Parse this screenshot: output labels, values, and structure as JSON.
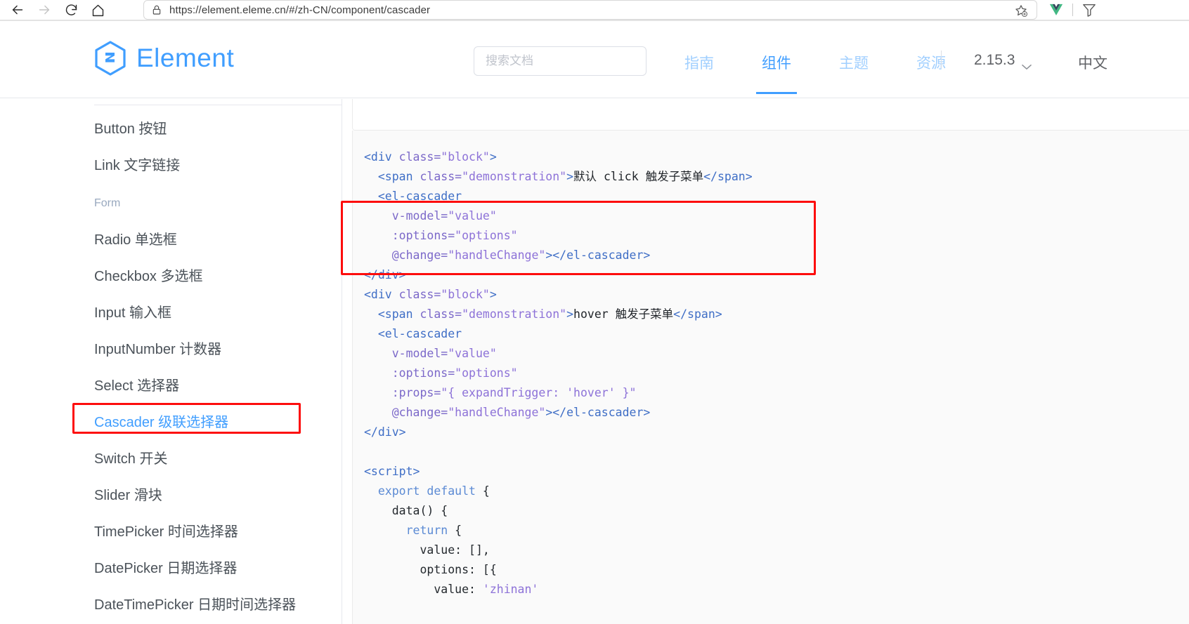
{
  "browser": {
    "back_label": "Back",
    "forward_label": "Forward",
    "reload_label": "Reload",
    "home_label": "Home",
    "url": "https://element.eleme.cn/#/zh-CN/component/cascader",
    "lock_icon": "lock-icon",
    "bookmark_icon": "bookmark-star-add-icon",
    "extension_icon": "vue-devtools-icon",
    "extension2_icon": "extension-icon"
  },
  "header": {
    "logo_text": "Element",
    "logo_icon": "element-hexagon-logo",
    "search": {
      "placeholder": "搜索文档",
      "value": ""
    },
    "nav": [
      {
        "label": "指南",
        "active": false
      },
      {
        "label": "组件",
        "active": true
      },
      {
        "label": "主题",
        "active": false
      },
      {
        "label": "资源",
        "active": false
      }
    ],
    "version": "2.15.3",
    "version_chevron": "chevron-down-icon",
    "language": "中文"
  },
  "sidebar": {
    "items": [
      {
        "label": "Button 按钮",
        "type": "item",
        "active": false
      },
      {
        "label": "Link 文字链接",
        "type": "item",
        "active": false
      },
      {
        "label": "Form",
        "type": "group",
        "active": false
      },
      {
        "label": "Radio 单选框",
        "type": "item",
        "active": false
      },
      {
        "label": "Checkbox 多选框",
        "type": "item",
        "active": false
      },
      {
        "label": "Input 输入框",
        "type": "item",
        "active": false
      },
      {
        "label": "InputNumber 计数器",
        "type": "item",
        "active": false
      },
      {
        "label": "Select 选择器",
        "type": "item",
        "active": false
      },
      {
        "label": "Cascader 级联选择器",
        "type": "item",
        "active": true
      },
      {
        "label": "Switch 开关",
        "type": "item",
        "active": false
      },
      {
        "label": "Slider 滑块",
        "type": "item",
        "active": false
      },
      {
        "label": "TimePicker 时间选择器",
        "type": "item",
        "active": false
      },
      {
        "label": "DatePicker 日期选择器",
        "type": "item",
        "active": false
      },
      {
        "label": "DateTimePicker 日期时间选择器",
        "type": "item",
        "active": false
      }
    ]
  },
  "annotations": {
    "color": "#fd0d0d",
    "sidebar_target": "Cascader 级联选择器",
    "code_target": "el-cascader element block"
  },
  "code": {
    "language": "html",
    "lines": [
      [
        [
          "tag",
          "<div "
        ],
        [
          "attr",
          "class="
        ],
        [
          "str",
          "\"block\""
        ],
        [
          "tag",
          ">"
        ]
      ],
      [
        [
          "txt",
          "  "
        ],
        [
          "tag",
          "<span "
        ],
        [
          "attr",
          "class="
        ],
        [
          "str",
          "\"demonstration\""
        ],
        [
          "tag",
          ">"
        ],
        [
          "txt",
          "默认 click 触发子菜单"
        ],
        [
          "tag",
          "</span>"
        ]
      ],
      [
        [
          "txt",
          "  "
        ],
        [
          "tag",
          "<el-cascader"
        ]
      ],
      [
        [
          "txt",
          "    "
        ],
        [
          "attr",
          "v-model="
        ],
        [
          "str",
          "\"value\""
        ]
      ],
      [
        [
          "txt",
          "    "
        ],
        [
          "attr",
          ":options="
        ],
        [
          "str",
          "\"options\""
        ]
      ],
      [
        [
          "txt",
          "    "
        ],
        [
          "attr",
          "@change="
        ],
        [
          "str",
          "\"handleChange\""
        ],
        [
          "tag",
          "></el-cascader>"
        ]
      ],
      [
        [
          "tag",
          "</div>"
        ]
      ],
      [
        [
          "tag",
          "<div "
        ],
        [
          "attr",
          "class="
        ],
        [
          "str",
          "\"block\""
        ],
        [
          "tag",
          ">"
        ]
      ],
      [
        [
          "txt",
          "  "
        ],
        [
          "tag",
          "<span "
        ],
        [
          "attr",
          "class="
        ],
        [
          "str",
          "\"demonstration\""
        ],
        [
          "tag",
          ">"
        ],
        [
          "txt",
          "hover 触发子菜单"
        ],
        [
          "tag",
          "</span>"
        ]
      ],
      [
        [
          "txt",
          "  "
        ],
        [
          "tag",
          "<el-cascader"
        ]
      ],
      [
        [
          "txt",
          "    "
        ],
        [
          "attr",
          "v-model="
        ],
        [
          "str",
          "\"value\""
        ]
      ],
      [
        [
          "txt",
          "    "
        ],
        [
          "attr",
          ":options="
        ],
        [
          "str",
          "\"options\""
        ]
      ],
      [
        [
          "txt",
          "    "
        ],
        [
          "attr",
          ":props="
        ],
        [
          "str",
          "\"{ expandTrigger: 'hover' }\""
        ]
      ],
      [
        [
          "txt",
          "    "
        ],
        [
          "attr",
          "@change="
        ],
        [
          "str",
          "\"handleChange\""
        ],
        [
          "tag",
          "></el-cascader>"
        ]
      ],
      [
        [
          "tag",
          "</div>"
        ]
      ],
      [
        [
          "txt",
          ""
        ]
      ],
      [
        [
          "tag",
          "<script>"
        ]
      ],
      [
        [
          "txt",
          "  "
        ],
        [
          "kw",
          "export default"
        ],
        [
          "plain",
          " {"
        ]
      ],
      [
        [
          "txt",
          "    "
        ],
        [
          "plain",
          "data() {"
        ]
      ],
      [
        [
          "txt",
          "      "
        ],
        [
          "kw",
          "return"
        ],
        [
          "plain",
          " {"
        ]
      ],
      [
        [
          "txt",
          "        "
        ],
        [
          "plain",
          "value: [],"
        ]
      ],
      [
        [
          "txt",
          "        "
        ],
        [
          "plain",
          "options: [{"
        ]
      ],
      [
        [
          "txt",
          "          "
        ],
        [
          "plain",
          "value: "
        ],
        [
          "sstr",
          "'zhinan'"
        ]
      ]
    ]
  }
}
